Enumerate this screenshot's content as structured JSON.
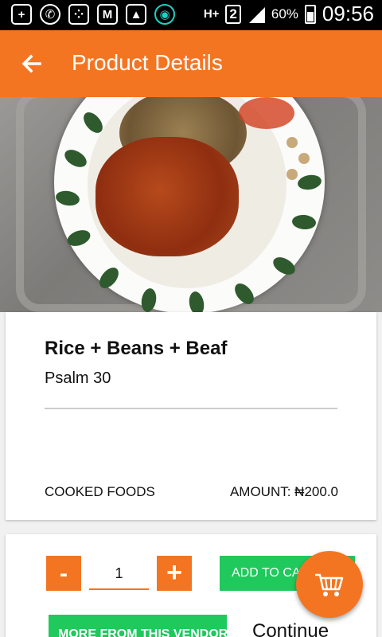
{
  "status_bar": {
    "icons": [
      "add-icon",
      "whatsapp-icon",
      "bbm-icon",
      "gmail-icon",
      "gallery-icon",
      "app-icon"
    ],
    "network": "H+",
    "sim": "2",
    "battery": "60%",
    "time": "09:56"
  },
  "app_bar": {
    "back_icon": "arrow-left-icon",
    "title": "Product Details",
    "color": "#f47521"
  },
  "product": {
    "image": "food-photo",
    "name": "Rice + Beans + Beaf",
    "vendor": "Psalm 30",
    "category": "COOKED FOODS",
    "amount": "AMOUNT: ₦200.0"
  },
  "actions": {
    "minus_label": "-",
    "quantity": "1",
    "plus_label": "+",
    "add_to_cart_label": "ADD TO CART",
    "more_label": "MORE FROM THIS VENDOR",
    "continue_label": "Continue",
    "accent_green": "#1fc95c"
  },
  "fab": {
    "icon": "cart-icon"
  }
}
